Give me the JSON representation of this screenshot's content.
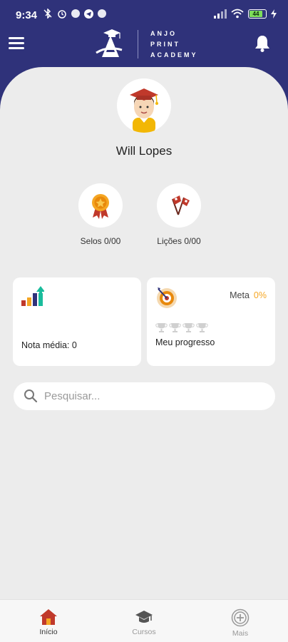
{
  "status_bar": {
    "time": "9:34",
    "battery": "44"
  },
  "header": {
    "logo_lines": [
      "ANJO",
      "PRINT",
      "ACADEMY"
    ]
  },
  "profile": {
    "name": "Will Lopes"
  },
  "stats": [
    {
      "label": "Selos 0/00",
      "icon": "medal-icon"
    },
    {
      "label": "Lições 0/00",
      "icon": "flags-icon"
    }
  ],
  "cards": {
    "grade": {
      "label": "Nota média: 0",
      "icon": "bar-chart-icon"
    },
    "progress": {
      "meta_label": "Meta",
      "meta_value": "0%",
      "label": "Meu progresso",
      "icon": "target-icon",
      "trophies_earned": 0,
      "trophies_total": 4
    }
  },
  "search": {
    "placeholder": "Pesquisar..."
  },
  "bottom_nav": [
    {
      "label": "Início",
      "icon": "home-icon"
    },
    {
      "label": "Cursos",
      "icon": "graduation-cap-icon"
    },
    {
      "label": "Mais",
      "icon": "plus-circle-icon"
    }
  ],
  "colors": {
    "brand": "#2f327a",
    "accent": "#f5a623",
    "home": "#c0392b"
  }
}
